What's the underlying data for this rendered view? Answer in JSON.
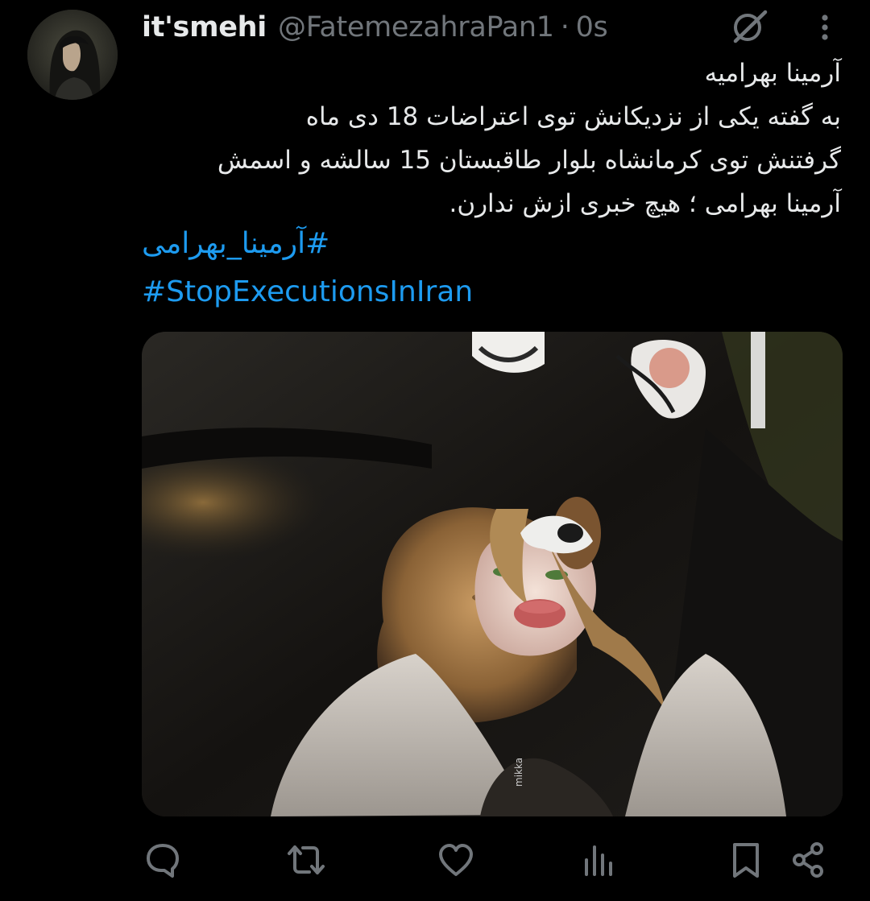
{
  "user": {
    "display_name": "it'smehi",
    "handle": "@FatemezahraPan1",
    "separator": "·",
    "time": "0s"
  },
  "tweet": {
    "lines": [
      "آرمینا بهرامیه",
      "به گفته یکی از نزدیکانش توی اعتراضات 18 دی ماه",
      "گرفتنش توی کرمانشاه بلوار طاقبستان 15 سالشه و اسمش",
      "آرمینا بهرامی ؛ هیچ خبری ازش ندارن."
    ],
    "hashtags": [
      "#آرمینا_بهرامی",
      "#StopExecutionsInIran"
    ]
  },
  "media": {
    "watermark": "mikka"
  },
  "icons": {
    "header": [
      "grok-icon",
      "more-icon"
    ],
    "actions": [
      "reply-icon",
      "retweet-icon",
      "like-icon",
      "views-icon",
      "bookmark-icon",
      "share-icon"
    ]
  },
  "colors": {
    "background": "#000000",
    "text": "#e7e9ea",
    "secondary": "#71767b",
    "link": "#1d9bf0"
  }
}
